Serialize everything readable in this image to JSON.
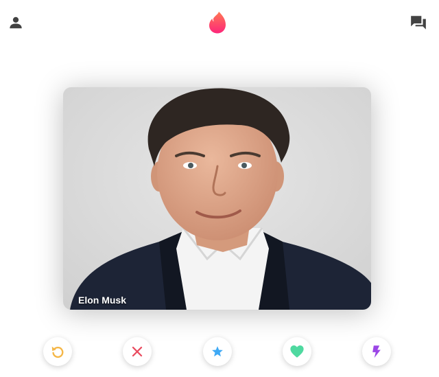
{
  "header": {
    "profile_icon": "person-icon",
    "logo_icon": "flame-icon",
    "chat_icon": "chat-bubbles-icon"
  },
  "card": {
    "name": "Elon Musk",
    "photo": "portrait-photo"
  },
  "actions": [
    {
      "icon": "rewind-icon",
      "color": "#f5b748"
    },
    {
      "icon": "close-icon",
      "color": "#e94a5e"
    },
    {
      "icon": "star-icon",
      "color": "#3ea9f5"
    },
    {
      "icon": "heart-icon",
      "color": "#4fd9a0"
    },
    {
      "icon": "lightning-icon",
      "color": "#9b46e6"
    }
  ],
  "colors": {
    "brand": "#fd5068",
    "icon_gray": "#424242"
  }
}
